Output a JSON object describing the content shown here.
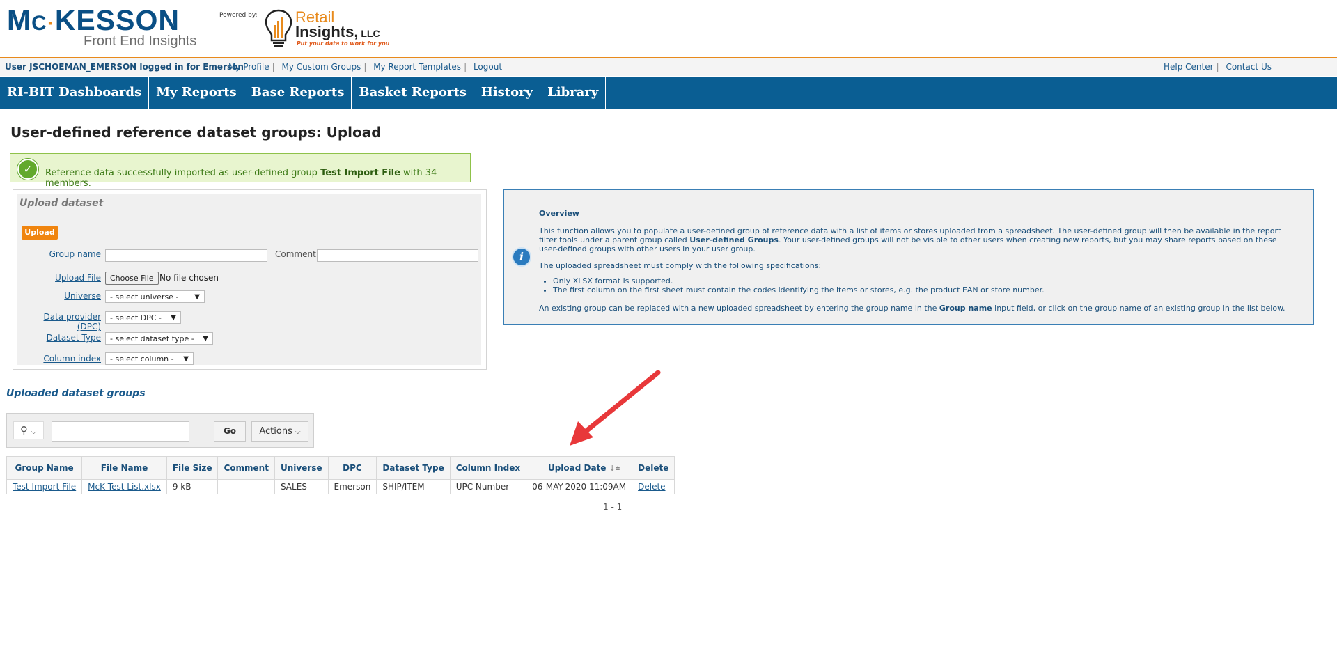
{
  "header": {
    "brand_mck_pre": "M",
    "brand_mck_c": "C",
    "brand_mck_post": "KESSON",
    "brand_sub": "Front End Insights",
    "powered_by": "Powered by:",
    "ri_retail": "Retail",
    "ri_insights": "Insights,",
    "ri_llc": " LLC",
    "ri_tagline": "Put your data to work for you"
  },
  "userbar": {
    "user_text": "User JSCHOEMAN_EMERSON logged in for Emerson",
    "links": [
      "My Profile",
      "My Custom Groups",
      "My Report Templates",
      "Logout"
    ],
    "right_links": [
      "Help Center",
      "Contact Us"
    ]
  },
  "nav": {
    "tabs": [
      "RI-BIT Dashboards",
      "My Reports",
      "Base Reports",
      "Basket Reports",
      "History",
      "Library"
    ]
  },
  "page": {
    "title": "User-defined reference dataset groups: Upload"
  },
  "success": {
    "prefix": "Reference data successfully imported as user-defined group ",
    "group": "Test Import File",
    "suffix": " with 34 members."
  },
  "upload": {
    "panel_title": "Upload dataset",
    "upload_button": "Upload",
    "group_name_label": "Group name",
    "comment_label": "Comment",
    "upload_file_label": "Upload File",
    "choose_file": "Choose File",
    "no_file": "No file chosen",
    "universe_label": "Universe",
    "universe_value": "- select universe -",
    "dpc_label": "Data provider (DPC)",
    "dpc_value": "- select DPC -",
    "dataset_type_label": "Dataset Type",
    "dataset_type_value": "- select dataset type -",
    "column_index_label": "Column index",
    "column_index_value": "- select column -"
  },
  "overview": {
    "title": "Overview",
    "p1_a": "This function allows you to populate a user-defined group of reference data with a list of items or stores uploaded from a spreadsheet. The user-defined group will then be available in the report filter tools under a parent group called ",
    "p1_b": "User-defined Groups",
    "p1_c": ". Your user-defined groups will not be visible to other users when creating new reports, but you may share reports based on these user-defined groups with other users in your user group.",
    "p2": "The uploaded spreadsheet must comply with the following specifications:",
    "bullets": [
      "Only XLSX format is supported.",
      "The first column on the first sheet must contain the codes identifying the items or stores, e.g. the product EAN or store number."
    ],
    "p3_a": "An existing group can be replaced with a new uploaded spreadsheet by entering the group name in the ",
    "p3_b": "Group name",
    "p3_c": " input field, or click on the group name of an existing group in the list below."
  },
  "groups": {
    "title": "Uploaded dataset groups",
    "go": "Go",
    "actions": "Actions",
    "columns": [
      "Group Name",
      "File Name",
      "File Size",
      "Comment",
      "Universe",
      "DPC",
      "Dataset Type",
      "Column Index",
      "Upload Date",
      "Delete"
    ],
    "rows": [
      [
        "Test Import File",
        "McK Test List.xlsx",
        "9 kB",
        "-",
        "SALES",
        "Emerson",
        "SHIP/ITEM",
        "UPC Number",
        "06-MAY-2020 11:09AM",
        "Delete"
      ]
    ],
    "pager": "1 - 1"
  },
  "colors": {
    "brand_blue": "#0a5e93",
    "accent_orange": "#e88a1c",
    "success_green": "#62a92c",
    "annotation_red": "#e8383a"
  }
}
